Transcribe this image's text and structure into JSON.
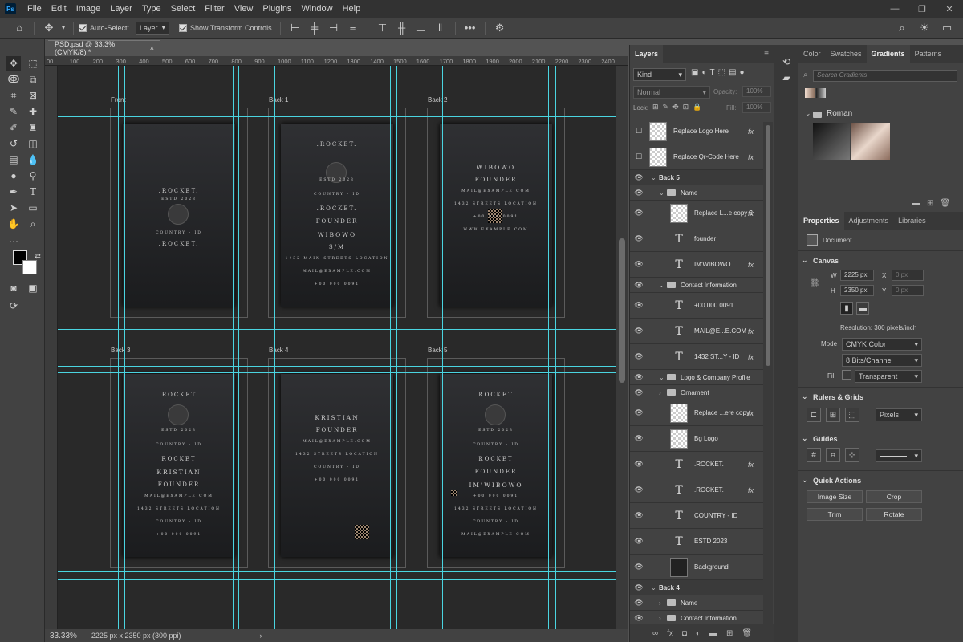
{
  "app": {
    "logo": "Ps"
  },
  "menu": [
    "File",
    "Edit",
    "Image",
    "Layer",
    "Type",
    "Select",
    "Filter",
    "View",
    "Plugins",
    "Window",
    "Help"
  ],
  "window_controls": [
    "—",
    "❐",
    "✕"
  ],
  "options": {
    "auto_select": "Auto-Select:",
    "auto_select_target": "Layer",
    "show_transform": "Show Transform Controls",
    "more": "•••"
  },
  "document": {
    "tab_title": "PSD.psd @ 33.3% (CMYK/8) *",
    "close": "×"
  },
  "ruler_ticks": [
    "00",
    "100",
    "200",
    "300",
    "400",
    "500",
    "600",
    "700",
    "800",
    "900",
    "1000",
    "1100",
    "1200",
    "1300",
    "1400",
    "1500",
    "1600",
    "1700",
    "1800",
    "1900",
    "2000",
    "2100",
    "2200",
    "2300",
    "2400"
  ],
  "cards": [
    {
      "label": "Front",
      "lines": [
        ".ROCKET.",
        "ESTD 2023",
        "COUNTRY - ID",
        ".ROCKET."
      ]
    },
    {
      "label": "Back 1",
      "lines": [
        ".ROCKET.",
        "ESTD 2023",
        "COUNTRY - ID",
        ".ROCKET.",
        "FOUNDER",
        "WIBOWO",
        "S/M",
        "1432 MAIN STREETS LOCATION",
        "MAIL@EXAMPLE.COM",
        "+00 000 0091"
      ]
    },
    {
      "label": "Back 2",
      "lines": [
        "WIBOWO",
        "FOUNDER",
        "MAIL@EXAMPLE.COM",
        "1432 STREETS LOCATION",
        "+00 000 0091",
        "WWW.EXAMPLE.COM"
      ]
    },
    {
      "label": "Back 3",
      "lines": [
        ".ROCKET.",
        "ESTD 2023",
        "COUNTRY - ID",
        "ROCKET",
        "KRISTIAN",
        "FOUNDER",
        "MAIL@EXAMPLE.COM",
        "1432 STREETS LOCATION",
        "COUNTRY - ID",
        "+00 000 0091"
      ]
    },
    {
      "label": "Back 4",
      "lines": [
        "KRISTIAN",
        "FOUNDER",
        "MAIL@EXAMPLE.COM",
        "1432 STREETS LOCATION",
        "COUNTRY - ID",
        "+00 000 0091"
      ]
    },
    {
      "label": "Back 5",
      "lines": [
        "ROCKET",
        "ESTD 2023",
        "COUNTRY - ID",
        "ROCKET",
        "FOUNDER",
        "IM'WIBOWO",
        "+00 000 0091",
        "1432 STREETS LOCATION",
        "COUNTRY - ID",
        "MAIL@EXAMPLE.COM"
      ]
    }
  ],
  "status": {
    "zoom": "33.33%",
    "doc_size": "2225 px x 2350 px (300 ppi)",
    "arrow": "›"
  },
  "layers_panel": {
    "tab": "Layers",
    "filter_kind": "Kind",
    "blend_mode": "Normal",
    "opacity_label": "Opacity:",
    "opacity": "100%",
    "lock_label": "Lock:",
    "fill_label": "Fill:",
    "fill": "100%",
    "rows": [
      {
        "name": "Replace Logo Here",
        "kind": "smart",
        "fx": "fx"
      },
      {
        "name": "Replace Qr-Code Here",
        "kind": "smart",
        "fx": "fx"
      },
      {
        "name": "Back 5",
        "kind": "group-open"
      },
      {
        "name": "Name",
        "kind": "folder-open"
      },
      {
        "name": "Replace L...e copy 2",
        "kind": "smart",
        "fx": "fx"
      },
      {
        "name": "founder",
        "kind": "text"
      },
      {
        "name": "IM'WIBOWO",
        "kind": "text",
        "fx": "fx"
      },
      {
        "name": "Contact Information",
        "kind": "folder-open"
      },
      {
        "name": "+00 000 0091",
        "kind": "text"
      },
      {
        "name": "MAIL@E...E.COM",
        "kind": "text",
        "fx": "fx"
      },
      {
        "name": "1432 ST...Y - ID",
        "kind": "text",
        "fx": "fx"
      },
      {
        "name": "Logo & Company Profile",
        "kind": "folder-open"
      },
      {
        "name": "Ornament",
        "kind": "folder-closed"
      },
      {
        "name": "Replace ...ere copy",
        "kind": "smart",
        "fx": "fx"
      },
      {
        "name": "Bg Logo",
        "kind": "smart"
      },
      {
        "name": ".ROCKET.",
        "kind": "text",
        "fx": "fx"
      },
      {
        "name": ".ROCKET.",
        "kind": "text",
        "fx": "fx"
      },
      {
        "name": "COUNTRY - ID",
        "kind": "text"
      },
      {
        "name": "ESTD 2023",
        "kind": "text"
      },
      {
        "name": "Background",
        "kind": "bg"
      },
      {
        "name": "Back 4",
        "kind": "group-open"
      },
      {
        "name": "Name",
        "kind": "folder-closed"
      },
      {
        "name": "Contact Information",
        "kind": "folder-closed"
      }
    ]
  },
  "gradients_panel": {
    "tabs": [
      "Color",
      "Swatches",
      "Gradients",
      "Patterns"
    ],
    "search_placeholder": "Search Gradients",
    "group": "Roman"
  },
  "properties_panel": {
    "tabs": [
      "Properties",
      "Adjustments",
      "Libraries"
    ],
    "doc_label": "Document",
    "canvas_title": "Canvas",
    "w_label": "W",
    "w": "2225 px",
    "x_label": "X",
    "x": "0 px",
    "h_label": "H",
    "h": "2350 px",
    "y_label": "Y",
    "y": "0 px",
    "resolution": "Resolution: 300 pixels/inch",
    "mode_label": "Mode",
    "mode": "CMYK Color",
    "bits": "8 Bits/Channel",
    "fill_label": "Fill",
    "fill": "Transparent",
    "rulers_title": "Rulers & Grids",
    "units": "Pixels",
    "guides_title": "Guides",
    "quick_title": "Quick Actions",
    "actions": [
      "Image Size",
      "Crop",
      "Trim",
      "Rotate"
    ]
  },
  "colors": {
    "guide": "#4ad4e0",
    "accent": "#31a8ff",
    "panel": "#424242"
  }
}
